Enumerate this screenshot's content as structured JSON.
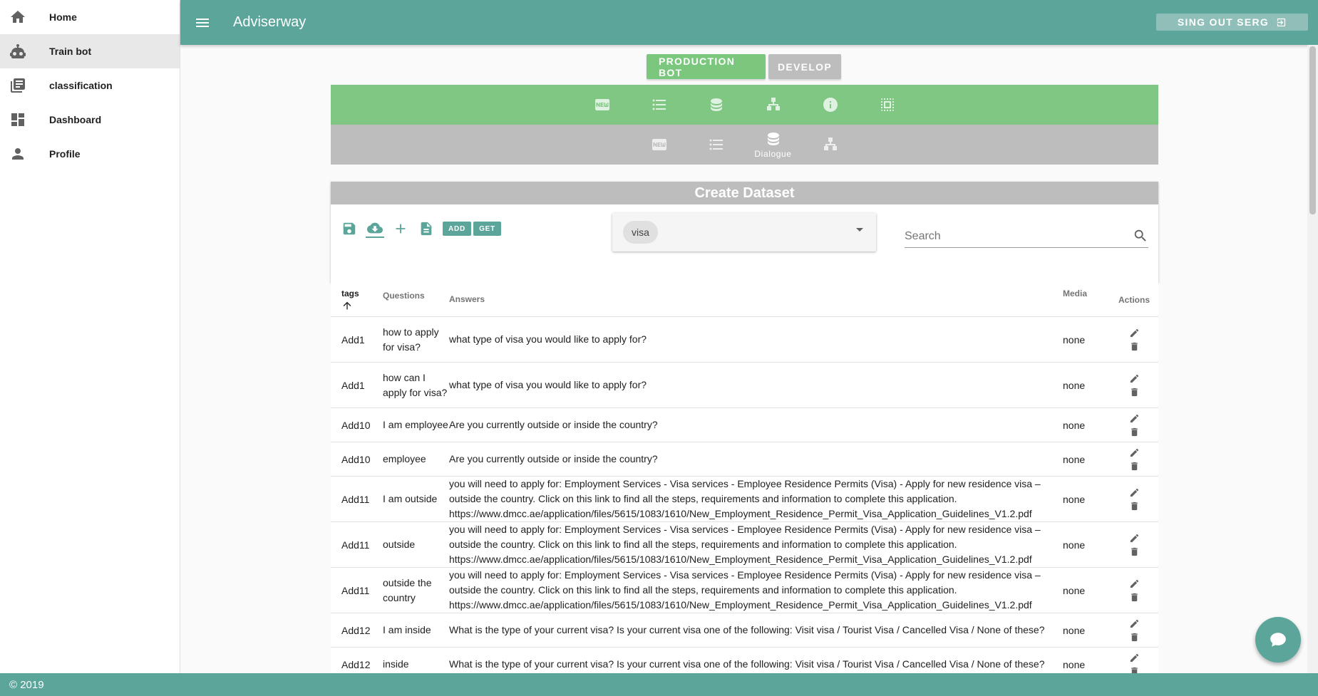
{
  "sidebar": {
    "items": [
      {
        "label": "Home",
        "icon": "home-icon"
      },
      {
        "label": "Train bot",
        "icon": "robot-icon",
        "active": true
      },
      {
        "label": "classification",
        "icon": "library-books-icon"
      },
      {
        "label": "Dashboard",
        "icon": "dashboard-icon"
      },
      {
        "label": "Profile",
        "icon": "person-icon"
      }
    ]
  },
  "appbar": {
    "title": "Adviserway",
    "signout_label": "SING OUT SERG"
  },
  "env": {
    "prod_label": "PRODUCTION BOT",
    "dev_label": "DEVELOP"
  },
  "grey_toolbar": {
    "active_label": "Dialogue"
  },
  "card": {
    "title": "Create Dataset",
    "add_label": "ADD",
    "get_label": "GET",
    "selected_tag": "visa",
    "search_placeholder": "Search"
  },
  "table": {
    "headers": {
      "tags": "tags",
      "questions": "Questions",
      "answers": "Answers",
      "media": "Media",
      "actions": "Actions"
    },
    "rows": [
      {
        "tag": "Add1",
        "question": "how to apply for visa?",
        "answer": "what type of visa you would like to apply for?",
        "media": "none"
      },
      {
        "tag": "Add1",
        "question": "how can I apply for visa?",
        "answer": "what type of visa you would like to apply for?",
        "media": "none"
      },
      {
        "tag": "Add10",
        "question": "I am employee",
        "answer": "Are you currently outside or inside the country?",
        "media": "none"
      },
      {
        "tag": "Add10",
        "question": "employee",
        "answer": "Are you currently outside or inside the country?",
        "media": "none"
      },
      {
        "tag": "Add11",
        "question": "I am outside",
        "answer": "you will need to apply for: Employment Services - Visa services - Employee Residence Permits (Visa) - Apply for new residence visa – outside the country. Click on this link to find all the steps, requirements and information to complete this application. https://www.dmcc.ae/application/files/5615/1083/1610/New_Employment_Residence_Permit_Visa_Application_Guidelines_V1.2.pdf",
        "media": "none"
      },
      {
        "tag": "Add11",
        "question": "outside",
        "answer": "you will need to apply for: Employment Services - Visa services - Employee Residence Permits (Visa) - Apply for new residence visa – outside the country. Click on this link to find all the steps, requirements and information to complete this application. https://www.dmcc.ae/application/files/5615/1083/1610/New_Employment_Residence_Permit_Visa_Application_Guidelines_V1.2.pdf",
        "media": "none"
      },
      {
        "tag": "Add11",
        "question": "outside the country",
        "answer": "you will need to apply for: Employment Services - Visa services - Employee Residence Permits (Visa) - Apply for new residence visa – outside the country. Click on this link to find all the steps, requirements and information to complete this application. https://www.dmcc.ae/application/files/5615/1083/1610/New_Employment_Residence_Permit_Visa_Application_Guidelines_V1.2.pdf",
        "media": "none"
      },
      {
        "tag": "Add12",
        "question": "I am inside",
        "answer": "What is the type of your current visa? Is your current visa one of the following: Visit visa / Tourist Visa / Cancelled Visa / None of these?",
        "media": "none"
      },
      {
        "tag": "Add12",
        "question": "inside",
        "answer": "What is the type of your current visa? Is your current visa one of the following: Visit visa / Tourist Visa / Cancelled Visa / None of these?",
        "media": "none"
      }
    ]
  },
  "footer": {
    "text": "© 2019"
  },
  "colors": {
    "primary": "#5ba59a",
    "green_bar": "#81c784",
    "grey_bar": "#bdbdbd"
  }
}
